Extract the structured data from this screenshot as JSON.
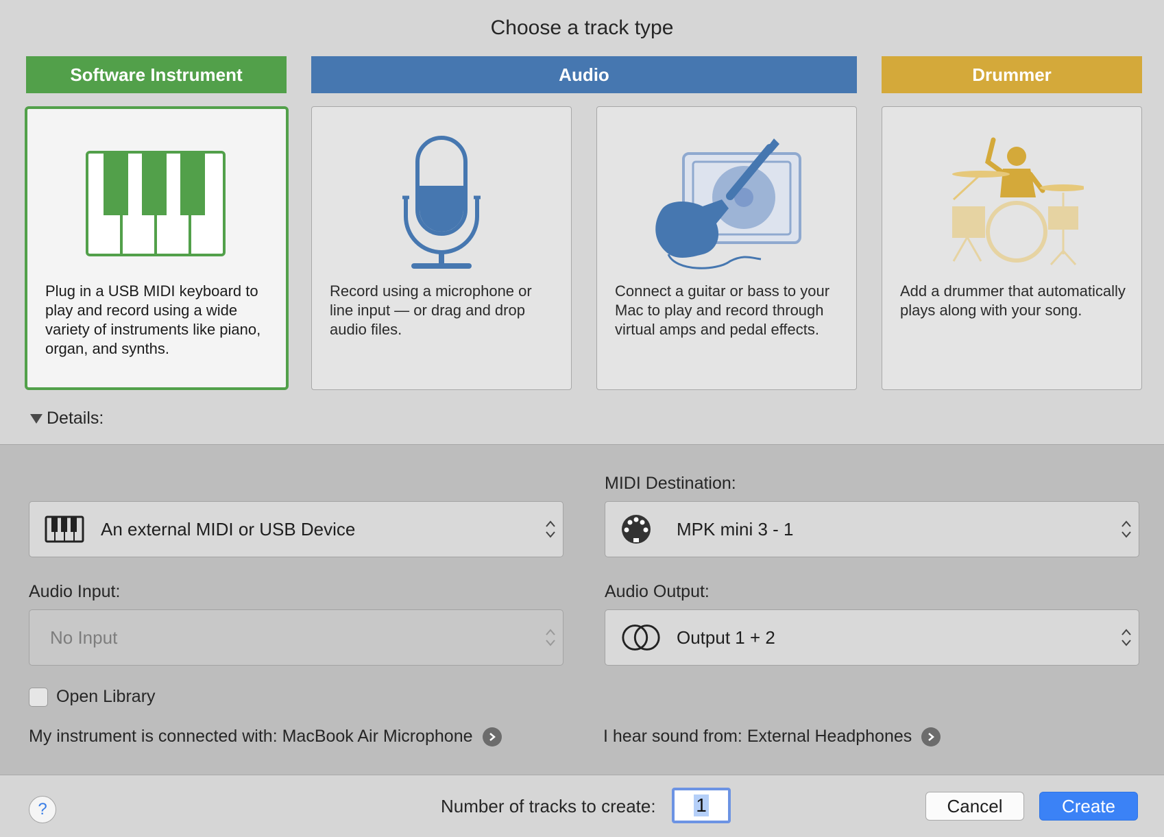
{
  "dialog": {
    "title": "Choose a track type"
  },
  "categories": [
    {
      "label": "Software Instrument",
      "color": "#52a04a"
    },
    {
      "label": "Audio",
      "color": "#4677b0"
    },
    {
      "label": "Drummer",
      "color": "#d4a93a"
    }
  ],
  "cards": [
    {
      "desc": "Plug in a USB MIDI keyboard to play and record using a wide variety of instruments like piano, organ, and synths.",
      "icon": "piano-keyboard-icon",
      "selected": true
    },
    {
      "desc": "Record using a microphone or line input — or drag and drop audio files.",
      "icon": "microphone-icon"
    },
    {
      "desc": "Connect a guitar or bass to your Mac to play and record through virtual amps and pedal effects.",
      "icon": "guitar-amp-icon"
    },
    {
      "desc": "Add a drummer that automatically plays along with your song.",
      "icon": "drummer-icon"
    }
  ],
  "details": {
    "toggle_label": "Details:",
    "midi_input_value": "An external MIDI or USB Device",
    "midi_destination_label": "MIDI Destination:",
    "midi_destination_value": "MPK mini 3 - 1",
    "audio_input_label": "Audio Input:",
    "audio_input_value": "No Input",
    "audio_output_label": "Audio Output:",
    "audio_output_value": "Output 1 + 2",
    "open_library_label": "Open Library",
    "connected_with": "My instrument is connected with: MacBook Air Microphone",
    "hear_sound_from": "I hear sound from: External Headphones"
  },
  "footer": {
    "help_label": "?",
    "tracks_label": "Number of tracks to create:",
    "tracks_value": "1",
    "cancel_label": "Cancel",
    "create_label": "Create"
  }
}
